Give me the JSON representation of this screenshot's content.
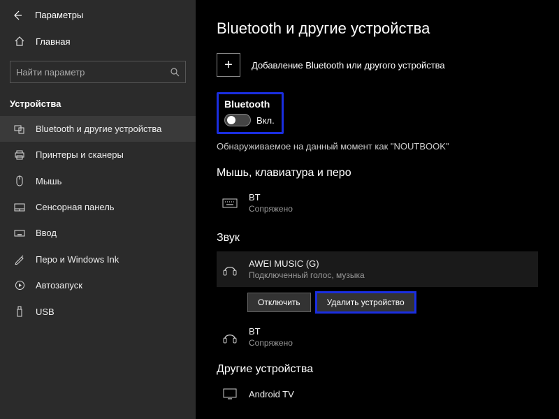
{
  "app": {
    "title": "Параметры"
  },
  "sidebar": {
    "home_label": "Главная",
    "search_placeholder": "Найти параметр",
    "category": "Устройства",
    "items": [
      {
        "label": "Bluetooth и другие устройства"
      },
      {
        "label": "Принтеры и сканеры"
      },
      {
        "label": "Мышь"
      },
      {
        "label": "Сенсорная панель"
      },
      {
        "label": "Ввод"
      },
      {
        "label": "Перо и Windows Ink"
      },
      {
        "label": "Автозапуск"
      },
      {
        "label": "USB"
      }
    ]
  },
  "main": {
    "title": "Bluetooth и другие устройства",
    "add_device_label": "Добавление Bluetooth или другого устройства",
    "bluetooth_heading": "Bluetooth",
    "toggle_state": "Вкл.",
    "discoverable_text": "Обнаруживаемое на данный момент как \"NOUTBOOK\"",
    "sections": {
      "input": {
        "heading": "Мышь, клавиатура и перо",
        "devices": [
          {
            "name": "BT",
            "status": "Сопряжено"
          }
        ]
      },
      "sound": {
        "heading": "Звук",
        "devices": [
          {
            "name": "AWEI MUSIC (G)",
            "status": "Подключенный голос, музыка"
          },
          {
            "name": "BT",
            "status": "Сопряжено"
          }
        ],
        "actions": {
          "disconnect": "Отключить",
          "remove": "Удалить устройство"
        }
      },
      "other": {
        "heading": "Другие устройства",
        "devices": [
          {
            "name": "Android TV",
            "status": ""
          }
        ]
      }
    }
  }
}
